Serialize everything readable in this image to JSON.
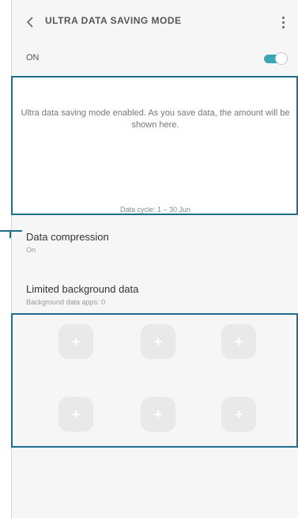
{
  "appbar": {
    "back_icon": "back-arrow-icon",
    "title": "ULTRA DATA SAVING MODE",
    "more_icon": "more-options-icon"
  },
  "master_switch": {
    "label": "ON",
    "state": true,
    "accent_color": "#3aa6b4"
  },
  "summary": {
    "message": "Ultra data saving mode enabled. As you save data, the amount will be shown here.",
    "data_cycle": "Data cycle: 1 – 30 Jun"
  },
  "data_compression": {
    "title": "Data compression",
    "status": "On"
  },
  "limited_background": {
    "title": "Limited background data",
    "subtitle": "Background data apps: 0"
  },
  "apps": [
    {
      "icon": "add-icon",
      "glyph": "+"
    },
    {
      "icon": "add-icon",
      "glyph": "+"
    },
    {
      "icon": "add-icon",
      "glyph": "+"
    },
    {
      "icon": "add-icon",
      "glyph": "+"
    },
    {
      "icon": "add-icon",
      "glyph": "+"
    },
    {
      "icon": "add-icon",
      "glyph": "+"
    }
  ],
  "callout_color": "#1f6f8b"
}
